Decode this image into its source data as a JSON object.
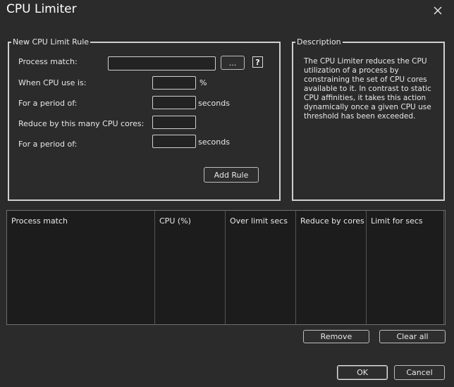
{
  "window": {
    "title": "CPU Limiter"
  },
  "rule_group": {
    "legend": "New CPU Limit Rule",
    "process_match_label": "Process match:",
    "process_match_value": "",
    "browse_label": "...",
    "help_label": "?",
    "cpu_use_label": "When CPU use is:",
    "cpu_use_value": "",
    "cpu_use_unit": "%",
    "period1_label": "For a period of:",
    "period1_value": "",
    "period1_unit": "seconds",
    "reduce_label": "Reduce by this many CPU cores:",
    "reduce_value": "",
    "period2_label": "For a period of:",
    "period2_value": "",
    "period2_unit": "seconds",
    "add_rule_label": "Add Rule"
  },
  "description": {
    "legend": "Description",
    "lines": [
      "The CPU Limiter reduces the CPU",
      "utilization of a process by",
      "constraining the set of CPU cores",
      "available to it. In contrast to static",
      "CPU affinities, it takes this action",
      "dynamically once a given CPU use",
      "threshold has been exceeded."
    ]
  },
  "rules_table": {
    "columns": [
      "Process match",
      "CPU (%)",
      "Over limit secs",
      "Reduce by cores",
      "Limit for secs"
    ],
    "rows": []
  },
  "buttons": {
    "remove": "Remove",
    "clear_all": "Clear all",
    "ok": "OK",
    "cancel": "Cancel"
  }
}
